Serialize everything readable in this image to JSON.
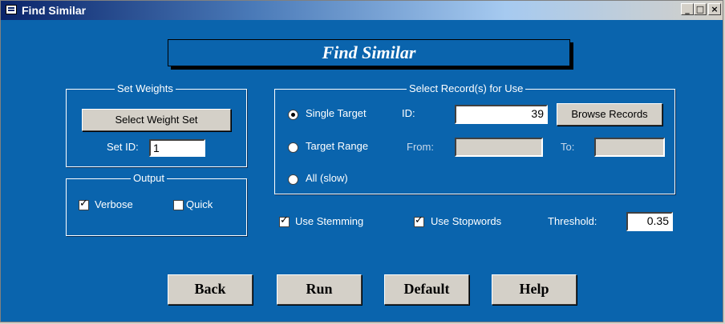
{
  "window": {
    "title": "Find Similar",
    "controls": {
      "minimize": "_",
      "maximize": "□",
      "close": "×"
    }
  },
  "header": {
    "title": "Find Similar"
  },
  "set_weights": {
    "legend": "Set Weights",
    "select_button": "Select Weight Set",
    "set_id_label": "Set ID:",
    "set_id_value": "1"
  },
  "output": {
    "legend": "Output",
    "verbose_label": "Verbose",
    "verbose_checked": true,
    "quick_label": "Quick",
    "quick_checked": false
  },
  "records": {
    "legend": "Select Record(s) for Use",
    "single_target_label": "Single Target",
    "single_target_selected": true,
    "id_label": "ID:",
    "id_value": "39",
    "browse_button": "Browse Records",
    "target_range_label": "Target Range",
    "from_label": "From:",
    "from_value": "",
    "to_label": "To:",
    "to_value": "",
    "all_label": "All (slow)"
  },
  "options": {
    "use_stemming_label": "Use Stemming",
    "use_stemming_checked": true,
    "use_stopwords_label": "Use Stopwords",
    "use_stopwords_checked": true,
    "threshold_label": "Threshold:",
    "threshold_value": "0.35"
  },
  "actions": {
    "back": "Back",
    "run": "Run",
    "default": "Default",
    "help": "Help"
  },
  "colors": {
    "form_background": "#0a64ad",
    "button_face": "#d4d0c8"
  }
}
